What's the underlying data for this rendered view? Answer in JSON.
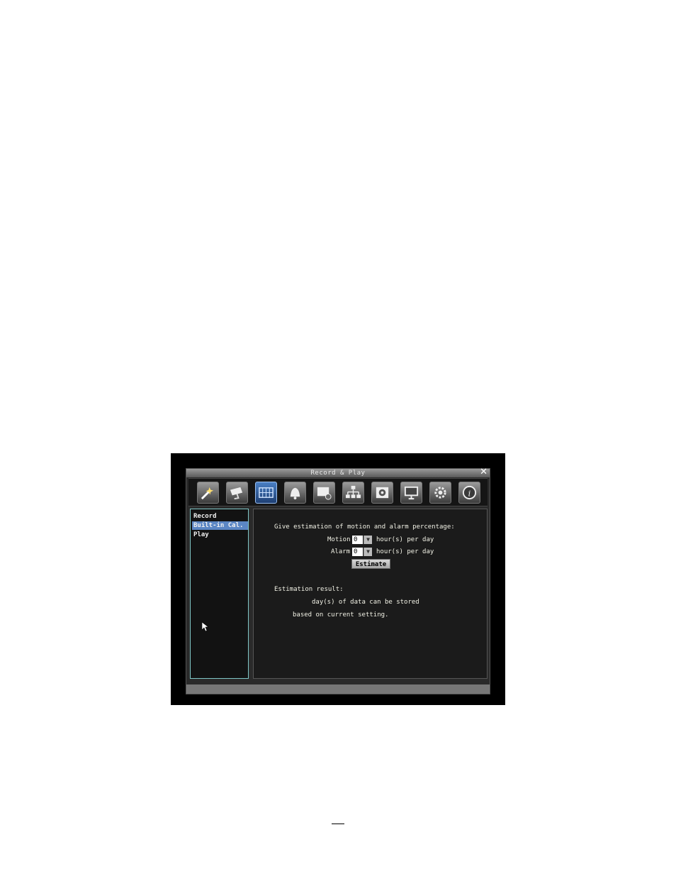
{
  "window": {
    "title": "Record & Play",
    "close_label": "✕"
  },
  "toolbar": {
    "buttons": [
      {
        "icon": "quick-setup-icon",
        "active": false
      },
      {
        "icon": "camera-icon",
        "active": false
      },
      {
        "icon": "record-play-icon",
        "active": true
      },
      {
        "icon": "alarm-bell-icon",
        "active": false
      },
      {
        "icon": "schedule-icon",
        "active": false
      },
      {
        "icon": "network-icon",
        "active": false
      },
      {
        "icon": "storage-icon",
        "active": false
      },
      {
        "icon": "monitor-icon",
        "active": false
      },
      {
        "icon": "system-settings-icon",
        "active": false
      },
      {
        "icon": "info-icon",
        "active": false
      }
    ]
  },
  "sidebar": {
    "items": [
      {
        "label": "Record"
      },
      {
        "label": "Built-in Cal."
      },
      {
        "label": "Play"
      }
    ],
    "selected_index": 1
  },
  "calculator": {
    "prompt": "Give estimation of motion and alarm percentage:",
    "motion_label": "Motion",
    "motion_value": "0",
    "alarm_label": "Alarm",
    "alarm_value": "0",
    "unit_text": "hour(s) per day",
    "estimate_label": "Estimate",
    "result_heading": "Estimation result:",
    "result_line1": "day(s) of data can be stored",
    "result_line2": "based on current setting."
  },
  "colors": {
    "selected": "#5b86c4",
    "panel_border": "#7fc6c6"
  }
}
